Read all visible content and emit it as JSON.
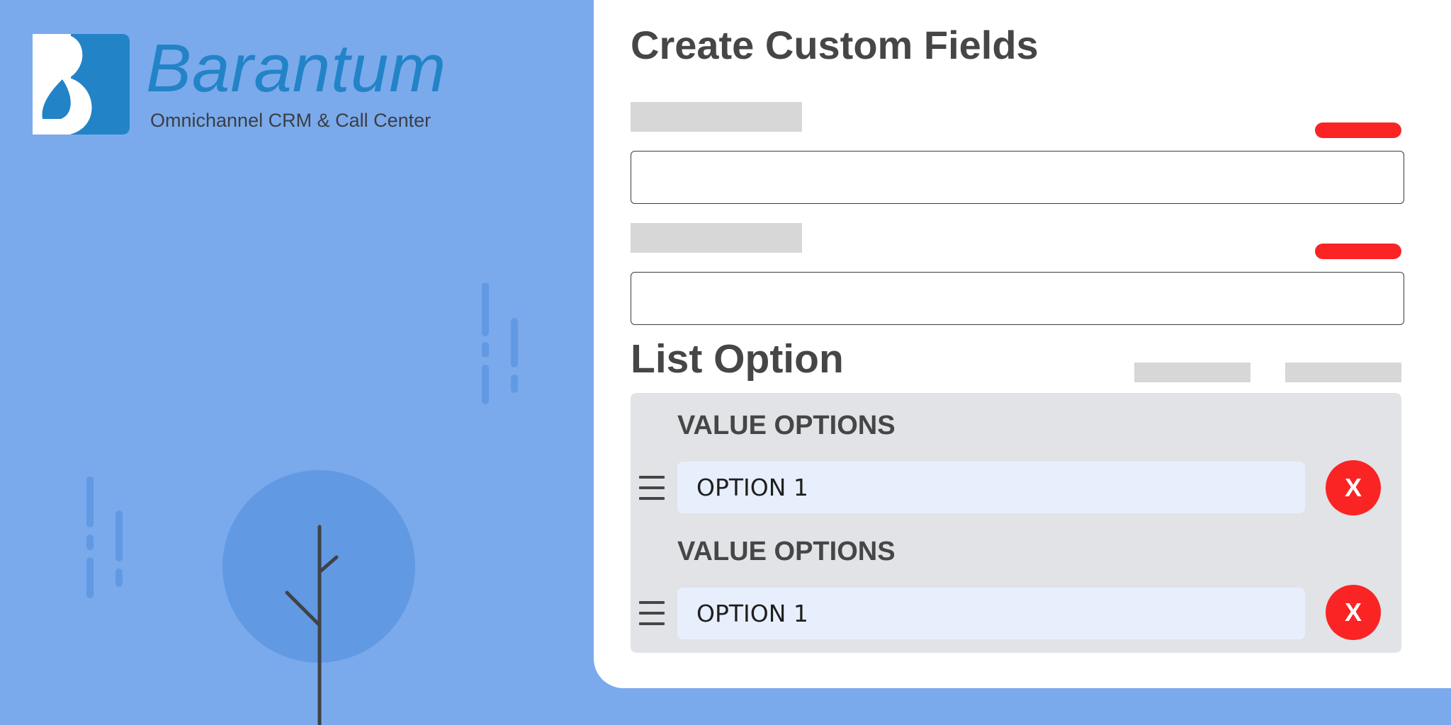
{
  "brand": {
    "name": "Barantum",
    "tagline": "Omnichannel CRM & Call Center",
    "colors": {
      "logo_blue": "#2383c7",
      "background": "#7aaaec",
      "tree_circle": "#6299e3",
      "tree_trunk": "#3f4247"
    }
  },
  "form": {
    "title": "Create Custom Fields",
    "fields": [
      {
        "label": "",
        "value": "",
        "placeholder": "",
        "required": true
      },
      {
        "label": "",
        "value": "",
        "placeholder": "",
        "required": true
      }
    ],
    "list_option": {
      "title": "List Option",
      "options": [
        {
          "label": "VALUE OPTIONS",
          "value": "OPTION 1",
          "remove_label": "X",
          "handle_icon": "drag-handle-icon"
        },
        {
          "label": "VALUE OPTIONS",
          "value": "OPTION 1",
          "remove_label": "X",
          "handle_icon": "drag-handle-icon"
        }
      ]
    },
    "colors": {
      "required": "#fa2424",
      "skeleton": "#d7d7d7",
      "panel": "#e1e3e7",
      "option_input": "#e8effc"
    }
  }
}
